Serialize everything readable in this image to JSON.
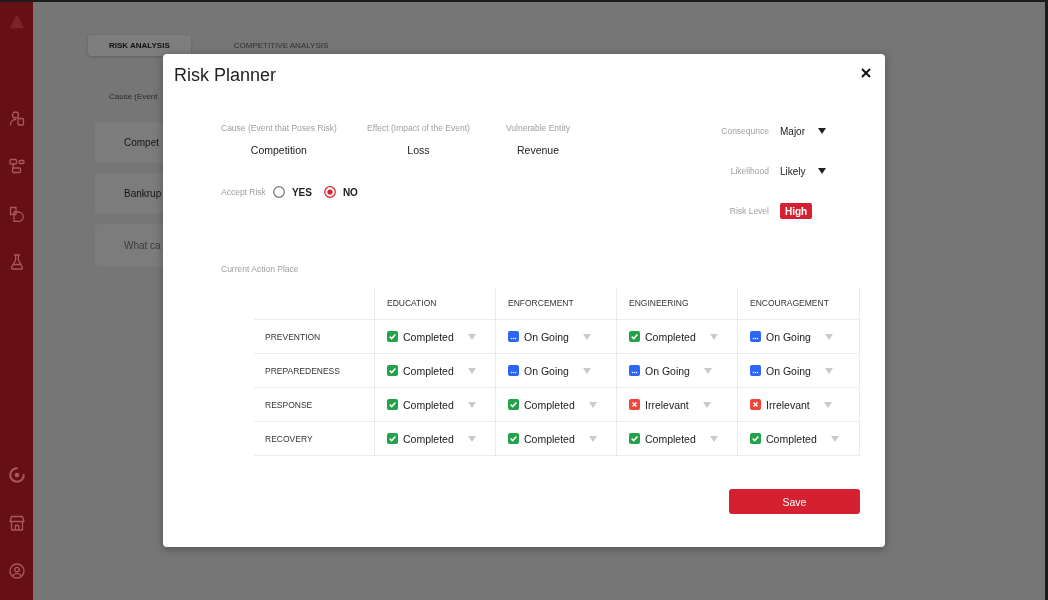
{
  "app": {
    "tabs": [
      {
        "label": "RISK ANALYSIS",
        "selected": true
      },
      {
        "label": "COMPETITIVE ANALYSIS",
        "selected": false
      }
    ],
    "cause_label": "Cause (Event",
    "causes": [
      "Compet",
      "Bankrup"
    ],
    "new_cause": {
      "placeholder": "What ca"
    }
  },
  "dialog": {
    "title": "Risk Planner",
    "fields": [
      {
        "label": "Cause (Event that Poses Risk)",
        "value": "Competition"
      },
      {
        "label": "Effect (Impact of the Event)",
        "value": "Loss"
      },
      {
        "label": "Vulnerable Entity",
        "value": "Revenue"
      }
    ],
    "accept_risk": {
      "label": "Accept Risk",
      "options": [
        {
          "label": "YES",
          "selected": false
        },
        {
          "label": "NO",
          "selected": true
        }
      ]
    },
    "consequence": {
      "label": "Consequnce",
      "value": "Major"
    },
    "likelihood": {
      "label": "Likelihood",
      "value": "Likely"
    },
    "risk_level": {
      "label": "Risk Level",
      "value": "High"
    },
    "action_plan": {
      "label": "Current Action Place",
      "columns": [
        "EDUCATION",
        "ENFORCEMENT",
        "ENGINEERING",
        "ENCOURAGEMENT"
      ],
      "rows": [
        {
          "label": "PREVENTION",
          "cells": [
            {
              "kind": "completed",
              "text": "Completed"
            },
            {
              "kind": "ongoing",
              "text": "On Going"
            },
            {
              "kind": "completed",
              "text": "Completed"
            },
            {
              "kind": "ongoing",
              "text": "On Going"
            }
          ]
        },
        {
          "label": "PREPAREDENESS",
          "cells": [
            {
              "kind": "completed",
              "text": "Completed"
            },
            {
              "kind": "ongoing",
              "text": "On Going"
            },
            {
              "kind": "ongoing",
              "text": "On Going"
            },
            {
              "kind": "ongoing",
              "text": "On Going"
            }
          ]
        },
        {
          "label": "RESPONSE",
          "cells": [
            {
              "kind": "completed",
              "text": "Completed"
            },
            {
              "kind": "completed",
              "text": "Completed"
            },
            {
              "kind": "irrelevant",
              "text": "Irrelevant"
            },
            {
              "kind": "irrelevant",
              "text": "Irrelevant"
            }
          ]
        },
        {
          "label": "RECOVERY",
          "cells": [
            {
              "kind": "completed",
              "text": "Completed"
            },
            {
              "kind": "completed",
              "text": "Completed"
            },
            {
              "kind": "completed",
              "text": "Completed"
            },
            {
              "kind": "completed",
              "text": "Completed"
            }
          ]
        }
      ]
    },
    "save_button": "Save"
  }
}
